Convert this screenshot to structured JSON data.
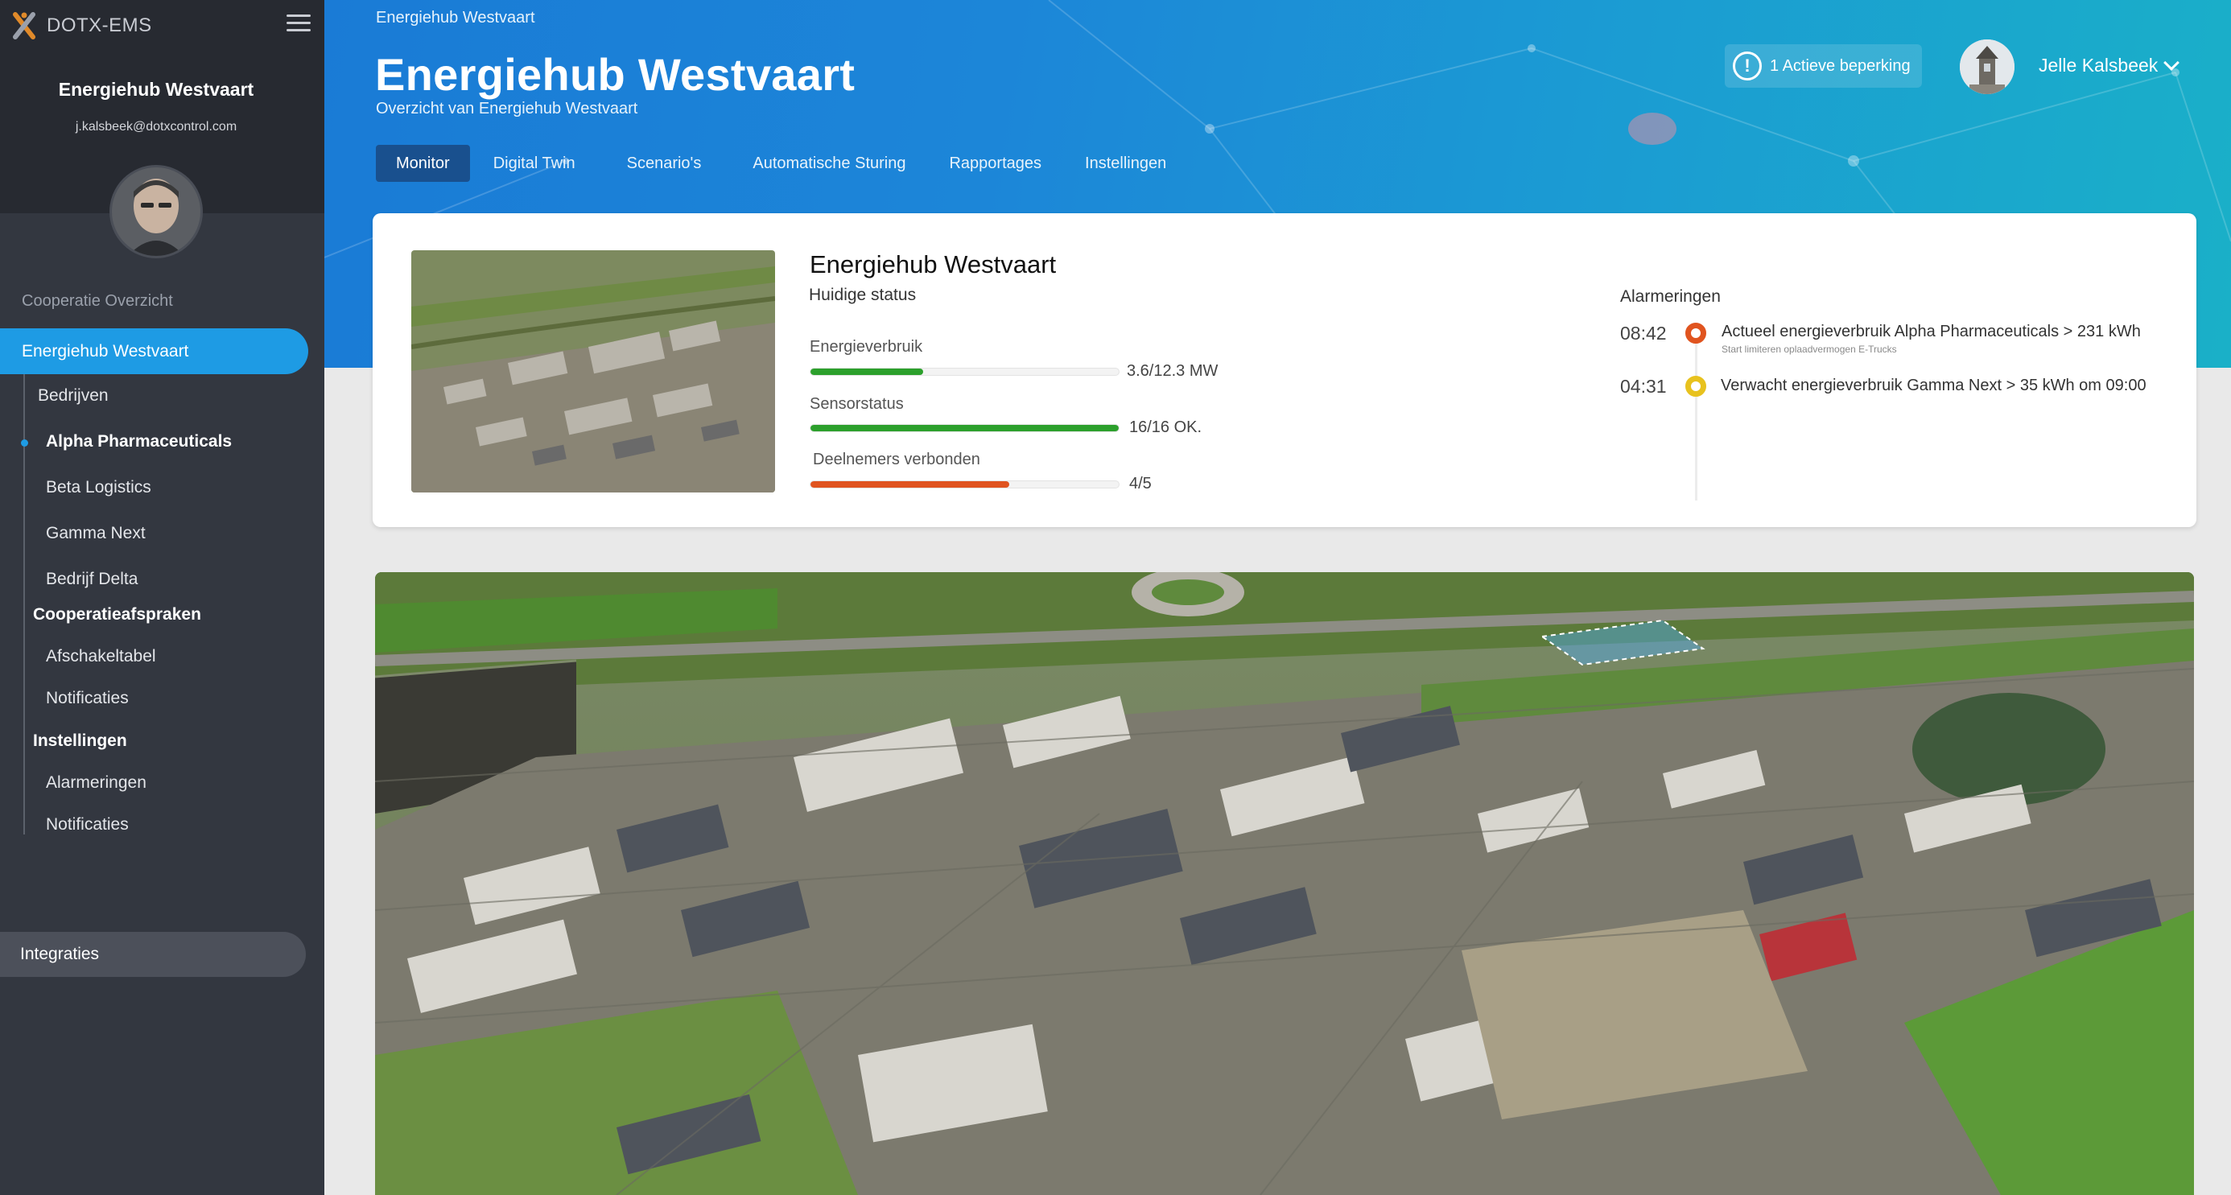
{
  "app": {
    "brand": "DOTX-EMS"
  },
  "sidebar": {
    "user_name": "Energiehub Westvaart",
    "user_email": "j.kalsbeek@dotxcontrol.com",
    "section_label": "Cooperatie Overzicht",
    "active_item": "Energiehub Westvaart",
    "items": [
      {
        "label": "Bedrijven"
      },
      {
        "label": "Alpha Pharmaceuticals"
      },
      {
        "label": "Beta Logistics"
      },
      {
        "label": "Gamma Next"
      },
      {
        "label": "Bedrijf Delta"
      },
      {
        "label": "Cooperatieafspraken"
      },
      {
        "label": "Afschakeltabel"
      },
      {
        "label": "Notificaties"
      },
      {
        "label": "Instellingen"
      },
      {
        "label": "Alarmeringen"
      },
      {
        "label": "Notificaties"
      }
    ],
    "integraties": "Integraties"
  },
  "header": {
    "breadcrumb": "Energiehub Westvaart",
    "title": "Energiehub Westvaart",
    "subtitle": "Overzicht van Energiehub Westvaart",
    "tabs": [
      {
        "label": "Monitor",
        "active": true
      },
      {
        "label": "Digital Twin"
      },
      {
        "label": "Scenario's"
      },
      {
        "label": "Automatische Sturing"
      },
      {
        "label": "Rapportages"
      },
      {
        "label": "Instellingen"
      }
    ],
    "alert_label": "1 Actieve beperking",
    "alert_icon": "!",
    "user_name": "Jelle Kalsbeek"
  },
  "card": {
    "title": "Energiehub Westvaart",
    "subtitle": "Huidige status",
    "metrics": [
      {
        "label": "Energieverbruik",
        "value": "3.6/12.3 MW",
        "fraction": 0.366,
        "color": "#2ca02c"
      },
      {
        "label": "Sensorstatus",
        "value": "16/16 OK.",
        "fraction": 1.0,
        "color": "#2ca02c"
      },
      {
        "label": "Deelnemers verbonden",
        "value": "4/5",
        "fraction": 0.645,
        "color": "#e0541f"
      }
    ],
    "alarms_label": "Alarmeringen",
    "alarms": [
      {
        "time": "08:42",
        "text": "Actueel energieverbruik Alpha Pharmaceuticals > 231 kWh",
        "subtext": "Start limiteren oplaadvermogen E-Trucks",
        "color": "#e0541f"
      },
      {
        "time": "04:31",
        "text": "Verwacht energieverbruik Gamma Next > 35 kWh om 09:00",
        "subtext": "",
        "color": "#e8c21e"
      }
    ]
  }
}
